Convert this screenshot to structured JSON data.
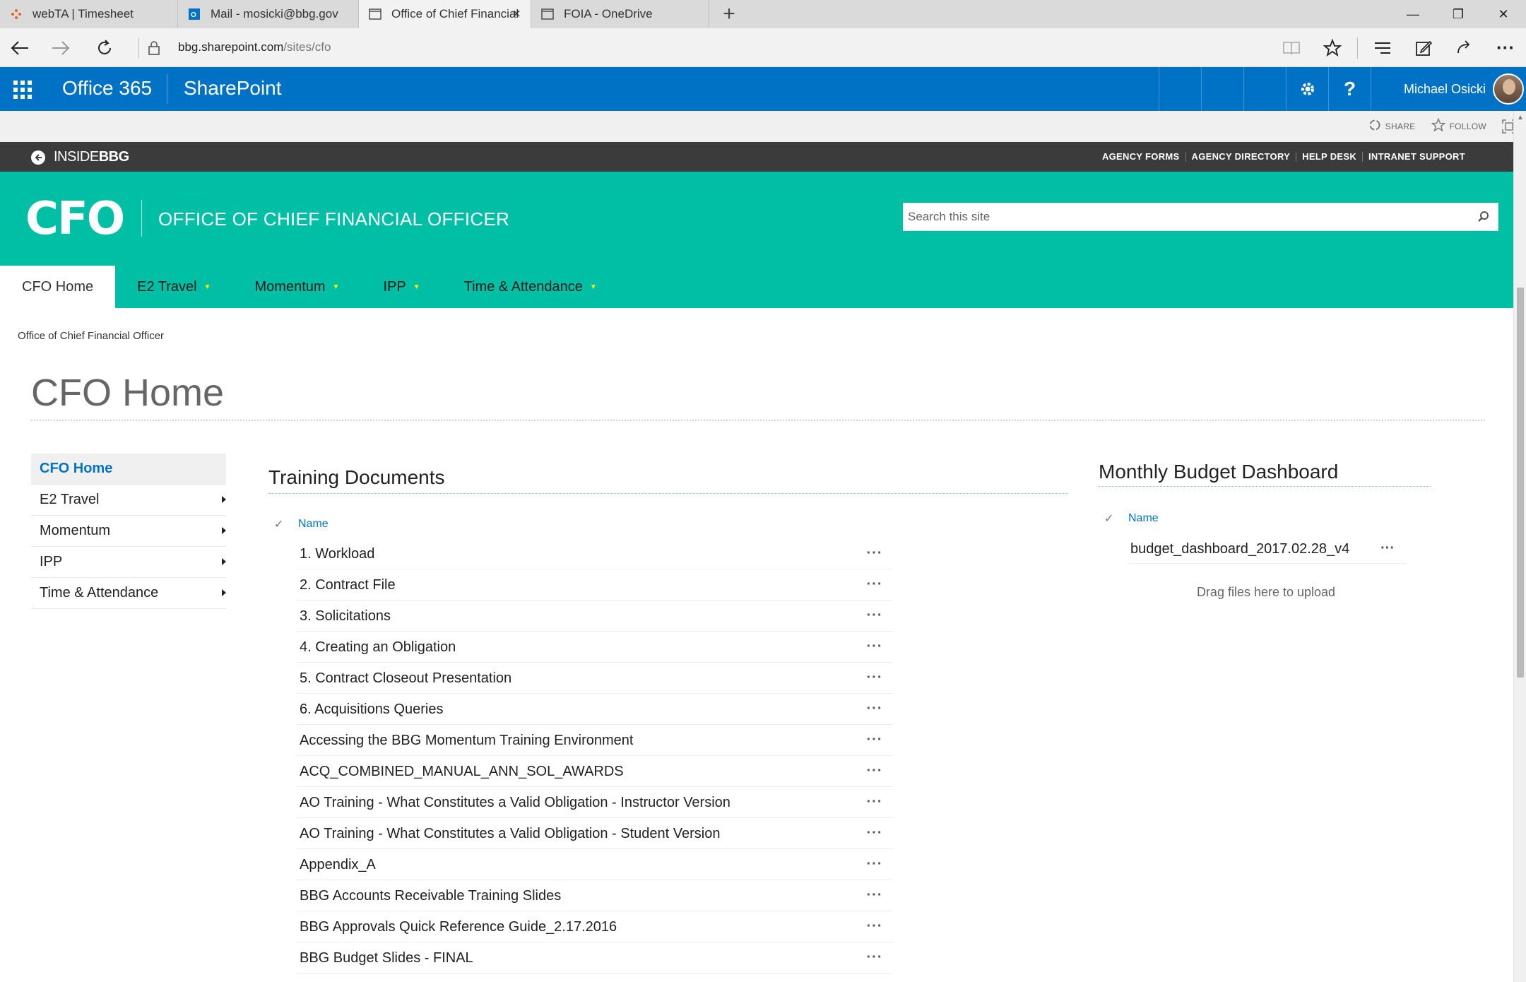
{
  "browser": {
    "tabs": [
      {
        "label": "webTA | Timesheet",
        "icon": "webta-icon",
        "active": false
      },
      {
        "label": "Mail - mosicki@bbg.gov",
        "icon": "outlook-icon",
        "active": false
      },
      {
        "label": "Office of Chief Financial",
        "icon": "page-icon",
        "active": true
      },
      {
        "label": "FOIA - OneDrive",
        "icon": "page-icon",
        "active": false
      }
    ],
    "new_tab": "+",
    "url_host": "bbg.sharepoint.com",
    "url_path": "/sites/cfo"
  },
  "suite": {
    "brand": "Office 365",
    "app": "SharePoint",
    "user_name": "Michael Osicki",
    "settings_icon": "gear-icon",
    "help_label": "?"
  },
  "ribbon": {
    "share": "SHARE",
    "follow": "FOLLOW"
  },
  "inside": {
    "logo_text": "INSIDE",
    "logo_bold": "BBG",
    "links": [
      "AGENCY FORMS",
      "AGENCY DIRECTORY",
      "HELP DESK",
      "INTRANET SUPPORT"
    ]
  },
  "site": {
    "logo": "CFO",
    "title": "OFFICE OF CHIEF FINANCIAL OFFICER",
    "search_placeholder": "Search this site",
    "accent_color": "#00bfa5"
  },
  "topnav": [
    {
      "label": "CFO Home",
      "selected": true,
      "dropdown": false
    },
    {
      "label": "E2 Travel",
      "selected": false,
      "dropdown": true
    },
    {
      "label": "Momentum",
      "selected": false,
      "dropdown": true
    },
    {
      "label": "IPP",
      "selected": false,
      "dropdown": true
    },
    {
      "label": "Time & Attendance",
      "selected": false,
      "dropdown": true
    }
  ],
  "breadcrumb": "Office of Chief Financial Officer",
  "page_title": "CFO Home",
  "quicklaunch": [
    {
      "label": "CFO Home",
      "selected": true,
      "flyout": false
    },
    {
      "label": "E2 Travel",
      "selected": false,
      "flyout": true
    },
    {
      "label": "Momentum",
      "selected": false,
      "flyout": true
    },
    {
      "label": "IPP",
      "selected": false,
      "flyout": true
    },
    {
      "label": "Time & Attendance",
      "selected": false,
      "flyout": true
    }
  ],
  "training": {
    "title": "Training Documents",
    "column": "Name",
    "items": [
      "1. Workload",
      "2. Contract File",
      "3. Solicitations",
      "4. Creating an Obligation",
      "5. Contract Closeout Presentation",
      "6. Acquisitions Queries",
      "Accessing the BBG Momentum Training Environment",
      "ACQ_COMBINED_MANUAL_ANN_SOL_AWARDS",
      "AO Training - What Constitutes a Valid Obligation - Instructor Version",
      "AO Training - What Constitutes a Valid Obligation - Student Version",
      "Appendix_A",
      "BBG Accounts Receivable Training Slides",
      "BBG Approvals Quick Reference Guide_2.17.2016",
      "BBG Budget Slides - FINAL"
    ],
    "more_label": "···"
  },
  "budget": {
    "title": "Monthly Budget Dashboard",
    "column": "Name",
    "items": [
      "budget_dashboard_2017.02.28_v4"
    ],
    "drop_text": "Drag files here to upload"
  }
}
